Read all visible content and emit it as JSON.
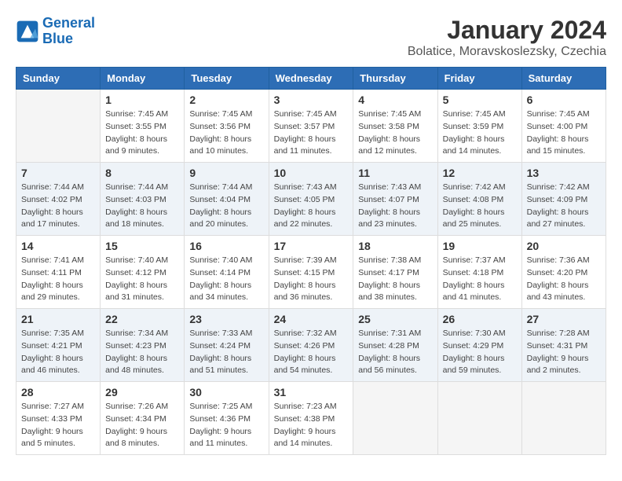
{
  "logo": {
    "line1": "General",
    "line2": "Blue"
  },
  "title": "January 2024",
  "location": "Bolatice, Moravskoslezsky, Czechia",
  "days_of_week": [
    "Sunday",
    "Monday",
    "Tuesday",
    "Wednesday",
    "Thursday",
    "Friday",
    "Saturday"
  ],
  "weeks": [
    [
      {
        "day": "",
        "info": ""
      },
      {
        "day": "1",
        "info": "Sunrise: 7:45 AM\nSunset: 3:55 PM\nDaylight: 8 hours\nand 9 minutes."
      },
      {
        "day": "2",
        "info": "Sunrise: 7:45 AM\nSunset: 3:56 PM\nDaylight: 8 hours\nand 10 minutes."
      },
      {
        "day": "3",
        "info": "Sunrise: 7:45 AM\nSunset: 3:57 PM\nDaylight: 8 hours\nand 11 minutes."
      },
      {
        "day": "4",
        "info": "Sunrise: 7:45 AM\nSunset: 3:58 PM\nDaylight: 8 hours\nand 12 minutes."
      },
      {
        "day": "5",
        "info": "Sunrise: 7:45 AM\nSunset: 3:59 PM\nDaylight: 8 hours\nand 14 minutes."
      },
      {
        "day": "6",
        "info": "Sunrise: 7:45 AM\nSunset: 4:00 PM\nDaylight: 8 hours\nand 15 minutes."
      }
    ],
    [
      {
        "day": "7",
        "info": "Sunrise: 7:44 AM\nSunset: 4:02 PM\nDaylight: 8 hours\nand 17 minutes."
      },
      {
        "day": "8",
        "info": "Sunrise: 7:44 AM\nSunset: 4:03 PM\nDaylight: 8 hours\nand 18 minutes."
      },
      {
        "day": "9",
        "info": "Sunrise: 7:44 AM\nSunset: 4:04 PM\nDaylight: 8 hours\nand 20 minutes."
      },
      {
        "day": "10",
        "info": "Sunrise: 7:43 AM\nSunset: 4:05 PM\nDaylight: 8 hours\nand 22 minutes."
      },
      {
        "day": "11",
        "info": "Sunrise: 7:43 AM\nSunset: 4:07 PM\nDaylight: 8 hours\nand 23 minutes."
      },
      {
        "day": "12",
        "info": "Sunrise: 7:42 AM\nSunset: 4:08 PM\nDaylight: 8 hours\nand 25 minutes."
      },
      {
        "day": "13",
        "info": "Sunrise: 7:42 AM\nSunset: 4:09 PM\nDaylight: 8 hours\nand 27 minutes."
      }
    ],
    [
      {
        "day": "14",
        "info": "Sunrise: 7:41 AM\nSunset: 4:11 PM\nDaylight: 8 hours\nand 29 minutes."
      },
      {
        "day": "15",
        "info": "Sunrise: 7:40 AM\nSunset: 4:12 PM\nDaylight: 8 hours\nand 31 minutes."
      },
      {
        "day": "16",
        "info": "Sunrise: 7:40 AM\nSunset: 4:14 PM\nDaylight: 8 hours\nand 34 minutes."
      },
      {
        "day": "17",
        "info": "Sunrise: 7:39 AM\nSunset: 4:15 PM\nDaylight: 8 hours\nand 36 minutes."
      },
      {
        "day": "18",
        "info": "Sunrise: 7:38 AM\nSunset: 4:17 PM\nDaylight: 8 hours\nand 38 minutes."
      },
      {
        "day": "19",
        "info": "Sunrise: 7:37 AM\nSunset: 4:18 PM\nDaylight: 8 hours\nand 41 minutes."
      },
      {
        "day": "20",
        "info": "Sunrise: 7:36 AM\nSunset: 4:20 PM\nDaylight: 8 hours\nand 43 minutes."
      }
    ],
    [
      {
        "day": "21",
        "info": "Sunrise: 7:35 AM\nSunset: 4:21 PM\nDaylight: 8 hours\nand 46 minutes."
      },
      {
        "day": "22",
        "info": "Sunrise: 7:34 AM\nSunset: 4:23 PM\nDaylight: 8 hours\nand 48 minutes."
      },
      {
        "day": "23",
        "info": "Sunrise: 7:33 AM\nSunset: 4:24 PM\nDaylight: 8 hours\nand 51 minutes."
      },
      {
        "day": "24",
        "info": "Sunrise: 7:32 AM\nSunset: 4:26 PM\nDaylight: 8 hours\nand 54 minutes."
      },
      {
        "day": "25",
        "info": "Sunrise: 7:31 AM\nSunset: 4:28 PM\nDaylight: 8 hours\nand 56 minutes."
      },
      {
        "day": "26",
        "info": "Sunrise: 7:30 AM\nSunset: 4:29 PM\nDaylight: 8 hours\nand 59 minutes."
      },
      {
        "day": "27",
        "info": "Sunrise: 7:28 AM\nSunset: 4:31 PM\nDaylight: 9 hours\nand 2 minutes."
      }
    ],
    [
      {
        "day": "28",
        "info": "Sunrise: 7:27 AM\nSunset: 4:33 PM\nDaylight: 9 hours\nand 5 minutes."
      },
      {
        "day": "29",
        "info": "Sunrise: 7:26 AM\nSunset: 4:34 PM\nDaylight: 9 hours\nand 8 minutes."
      },
      {
        "day": "30",
        "info": "Sunrise: 7:25 AM\nSunset: 4:36 PM\nDaylight: 9 hours\nand 11 minutes."
      },
      {
        "day": "31",
        "info": "Sunrise: 7:23 AM\nSunset: 4:38 PM\nDaylight: 9 hours\nand 14 minutes."
      },
      {
        "day": "",
        "info": ""
      },
      {
        "day": "",
        "info": ""
      },
      {
        "day": "",
        "info": ""
      }
    ]
  ]
}
